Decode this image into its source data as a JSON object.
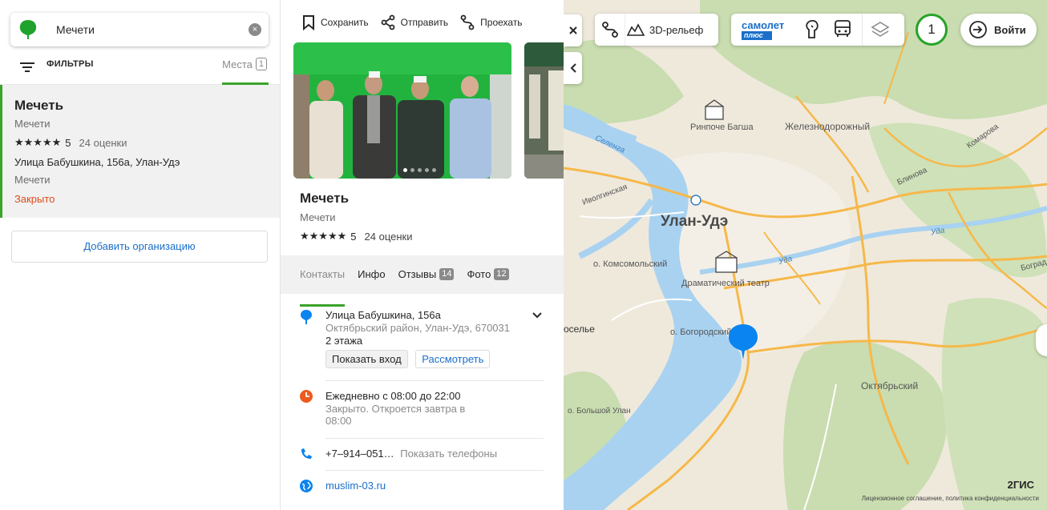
{
  "search": {
    "value": "Мечети",
    "clear_glyph": "×"
  },
  "filters": {
    "label": "ФИЛЬТРЫ",
    "places_label": "Места",
    "places_count": "1"
  },
  "result": {
    "title": "Мечеть",
    "subtitle": "Мечети",
    "stars": "★★★★★",
    "rating": "5",
    "reviews": "24 оценки",
    "address": "Улица Бабушкина, 156а, Улан-Удэ",
    "category": "Мечети",
    "status": "Закрыто"
  },
  "add_org": "Добавить организацию",
  "actions": {
    "save": "Сохранить",
    "share": "Отправить",
    "route": "Проехать"
  },
  "card": {
    "title": "Мечеть",
    "subtitle": "Мечети",
    "stars": "★★★★★",
    "rating": "5",
    "reviews": "24 оценки"
  },
  "tabs": [
    {
      "label": "Контакты"
    },
    {
      "label": "Инфо"
    },
    {
      "label": "Отзывы",
      "count": "14"
    },
    {
      "label": "Фото",
      "count": "12"
    }
  ],
  "contacts": {
    "address_line": "Улица Бабушкина, 156а",
    "address_district": "Октябрьский район, Улан-Удэ, 670031",
    "floors": "2 этажа",
    "show_entrance": "Показать вход",
    "view": "Рассмотреть",
    "hours": "Ежедневно с 08:00 до 22:00",
    "hours_status": "Закрыто. Откроется завтра в 08:00",
    "phone": "+7‒914‒051…",
    "show_phones": "Показать телефоны",
    "website": "muslim-03.ru"
  },
  "map": {
    "relief_label": "3D-рельеф",
    "samolet_top": "самолет",
    "samolet_bottom": "плюс",
    "layers_count": "1",
    "login": "Войти",
    "labels": {
      "rinpoche": "Ринпоче Багша",
      "zheleznodorozhny": "Железнодорожный",
      "city": "Улан-Удэ",
      "ivolginskaya": "Иволгинская",
      "komsomolsky": "о. Комсомольский",
      "theatre": "Драматический театр",
      "bogorodsky": "о. Богородский",
      "oktyabrsky": "Октябрьский",
      "bolshoy_ulan": "о. Большой Улан",
      "selo": "оселье",
      "selenga": "Селенга",
      "uda1": "Уда",
      "uda2": "Уда",
      "komarova": "Комарова",
      "blinova": "Блинова",
      "bograd": "Боград"
    },
    "brand": "2ГИС",
    "legal": "Лицензионное соглашение, политика конфиденциальности"
  },
  "colors": {
    "accent": "#3aa32a",
    "link": "#1a6fc9",
    "closed": "#e04b1a",
    "pin": "#0a84f0"
  }
}
